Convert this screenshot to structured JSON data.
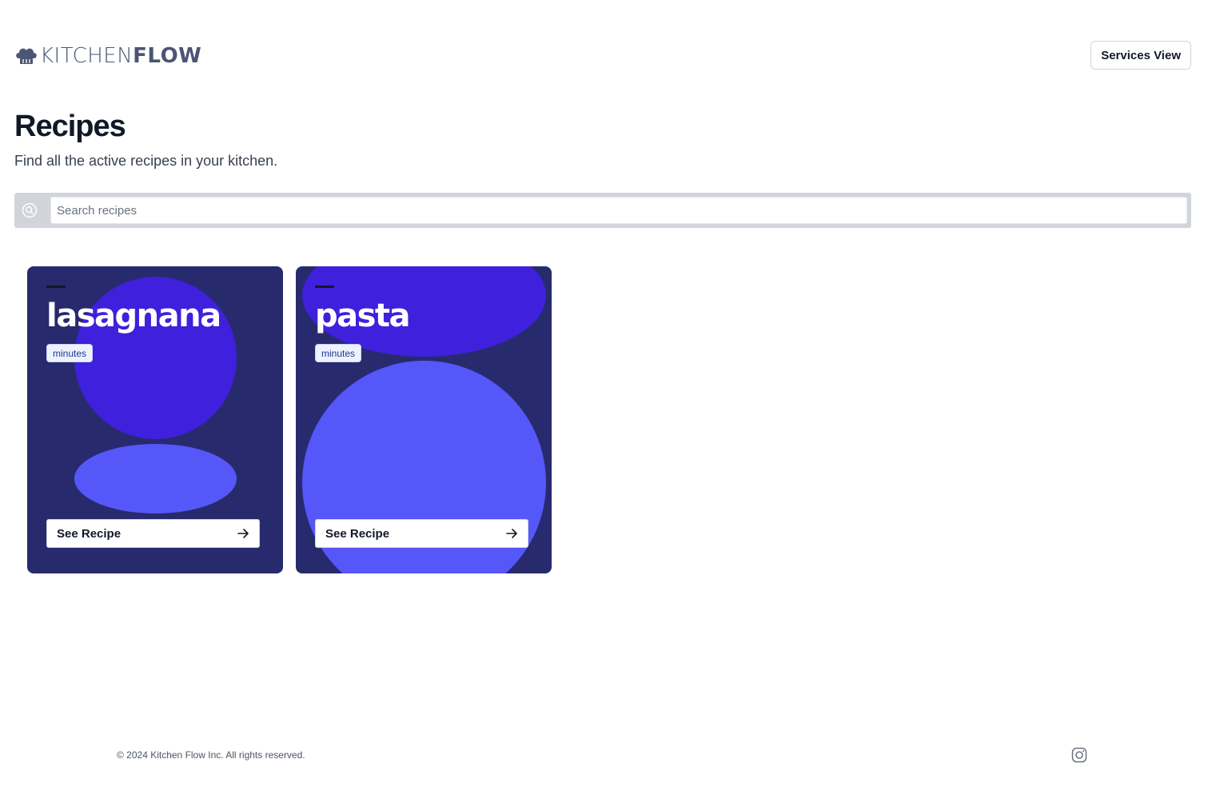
{
  "header": {
    "logo_light": "KITCHEN",
    "logo_bold": "FLOW",
    "services_button": "Services View"
  },
  "page": {
    "title": "Recipes",
    "subtitle": "Find all the active recipes in your kitchen."
  },
  "search": {
    "placeholder": "Search recipes",
    "value": ""
  },
  "recipes": [
    {
      "title": "lasagnana",
      "badge": "minutes",
      "button": "See Recipe"
    },
    {
      "title": "pasta",
      "badge": "minutes",
      "button": "See Recipe"
    }
  ],
  "footer": {
    "copyright": "© 2024 Kitchen Flow Inc. All rights reserved."
  },
  "icons": {
    "logo": "chef-hat-icon",
    "search": "search-icon",
    "arrow": "arrow-right-icon",
    "social": "instagram-icon"
  },
  "colors": {
    "card_bg": "#282a6e",
    "shape_dark": "#3f20dc",
    "shape_light": "#5557f9"
  }
}
